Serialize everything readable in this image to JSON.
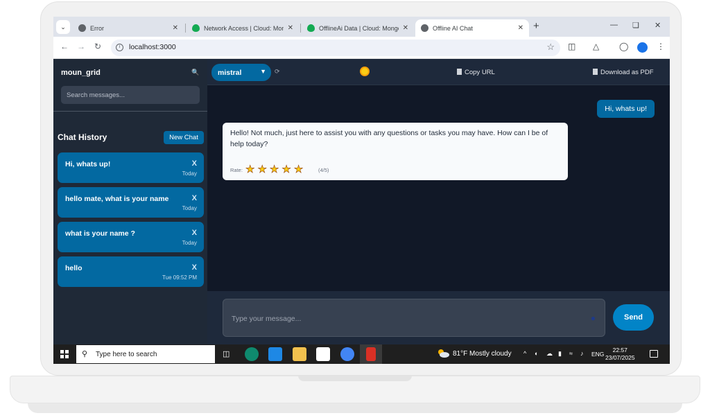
{
  "browser": {
    "tabs": [
      {
        "title": "Error",
        "icon": "globe-icon"
      },
      {
        "title": "Network Access | Cloud: MongoDB",
        "icon": "mongodb-leaf-icon"
      },
      {
        "title": "OfflineAi Data | Cloud: MongoDB",
        "icon": "mongodb-leaf-icon"
      },
      {
        "title": "Offline AI Chat",
        "icon": "globe-icon"
      }
    ],
    "url": "localhost:3000"
  },
  "sidebar": {
    "title": "moun_grid",
    "search_placeholder": "Search messages...",
    "history_title": "Chat History",
    "new_chat_label": "New Chat",
    "chats": [
      {
        "label": "Hi, whats up!",
        "close": "X",
        "time": "Today"
      },
      {
        "label": "hello mate, what is your name",
        "close": "X",
        "time": "Today"
      },
      {
        "label": "what is your name ?",
        "close": "X",
        "time": "Today"
      },
      {
        "label": "hello",
        "close": "X",
        "time": "Tue 09:52 PM"
      }
    ]
  },
  "topbar": {
    "model": "mistral",
    "copy_url": "Copy URL",
    "download_pdf": "Download as PDF"
  },
  "messages": {
    "user": "Hi, whats up!",
    "bot": "Hello! Not much, just here to assist you with any questions or tasks you may have. How can I be of help today?",
    "rate_label": "Rate:",
    "rating": 4,
    "rating_text": "(4/5)"
  },
  "composer": {
    "placeholder": "Type your message...",
    "send_label": "Send"
  },
  "taskbar": {
    "search_text": "Type here to search",
    "weather": "81°F  Mostly cloudy",
    "lang": "ENG",
    "time": "22:57",
    "date": "23/07/2025"
  },
  "colors": {
    "accent": "#0369a1",
    "sidebar_bg": "#1f2937",
    "main_bg": "#111827"
  }
}
